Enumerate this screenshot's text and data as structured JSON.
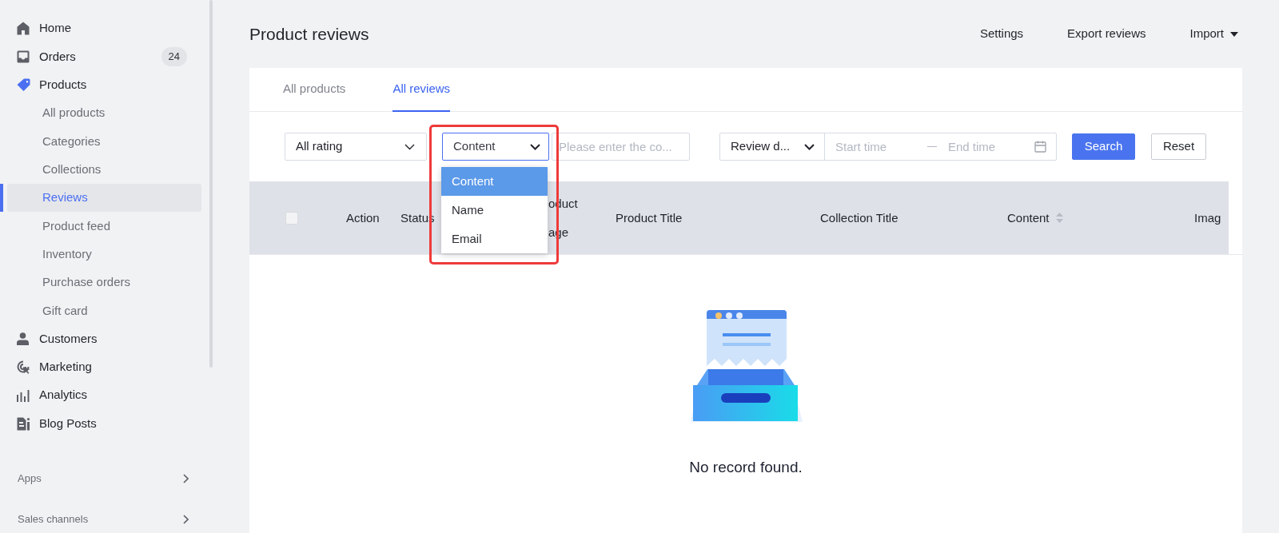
{
  "sidebar": {
    "items": [
      {
        "label": "Home",
        "selected": false
      },
      {
        "label": "Orders",
        "selected": false,
        "badge": "24"
      },
      {
        "label": "Products",
        "selected": true,
        "expanded": true,
        "children": [
          {
            "label": "All products",
            "selected": false
          },
          {
            "label": "Categories",
            "selected": false
          },
          {
            "label": "Collections",
            "selected": false
          },
          {
            "label": "Reviews",
            "selected": true
          },
          {
            "label": "Product feed",
            "selected": false
          },
          {
            "label": "Inventory",
            "selected": false
          },
          {
            "label": "Purchase orders",
            "selected": false
          },
          {
            "label": "Gift card",
            "selected": false
          }
        ]
      },
      {
        "label": "Customers",
        "selected": false
      },
      {
        "label": "Marketing",
        "selected": false
      },
      {
        "label": "Analytics",
        "selected": false
      },
      {
        "label": "Blog Posts",
        "selected": false
      }
    ],
    "sections": [
      {
        "label": "Apps"
      },
      {
        "label": "Sales channels"
      }
    ]
  },
  "page": {
    "title": "Product reviews",
    "actions": [
      {
        "label": "Settings",
        "kind": "link"
      },
      {
        "label": "Export reviews",
        "kind": "link"
      },
      {
        "label": "Import",
        "kind": "menu"
      }
    ]
  },
  "tabs": [
    {
      "label": "All products",
      "selected": false
    },
    {
      "label": "All reviews",
      "selected": true
    }
  ],
  "filters": {
    "rating": {
      "value": "All rating"
    },
    "field": {
      "value": "Content",
      "expanded": true,
      "options": [
        {
          "label": "Content",
          "selected": true
        },
        {
          "label": "Name",
          "selected": false
        },
        {
          "label": "Email",
          "selected": false
        }
      ]
    },
    "keyword": {
      "placeholder": "Please enter the co..."
    },
    "date_type": {
      "value": "Review d..."
    },
    "start": {
      "placeholder": "Start time"
    },
    "end": {
      "placeholder": "End time"
    },
    "buttons": [
      {
        "label": "Search",
        "kind": "primary"
      },
      {
        "label": "Reset",
        "kind": "default"
      }
    ]
  },
  "table": {
    "select_all": {
      "checked": false
    },
    "columns": [
      {
        "lines": [
          "Action"
        ],
        "sortable": false
      },
      {
        "lines": [
          "Status"
        ],
        "sortable": false
      },
      {
        "lines": [
          "oduct",
          "age"
        ],
        "sortable": false
      },
      {
        "lines": [
          "Product Title"
        ],
        "sortable": false
      },
      {
        "lines": [
          "Collection Title"
        ],
        "sortable": false
      },
      {
        "lines": [
          "Content"
        ],
        "sortable": true
      },
      {
        "lines": [
          "Imag"
        ],
        "sortable": false
      }
    ]
  },
  "empty": {
    "message": "No record found."
  }
}
